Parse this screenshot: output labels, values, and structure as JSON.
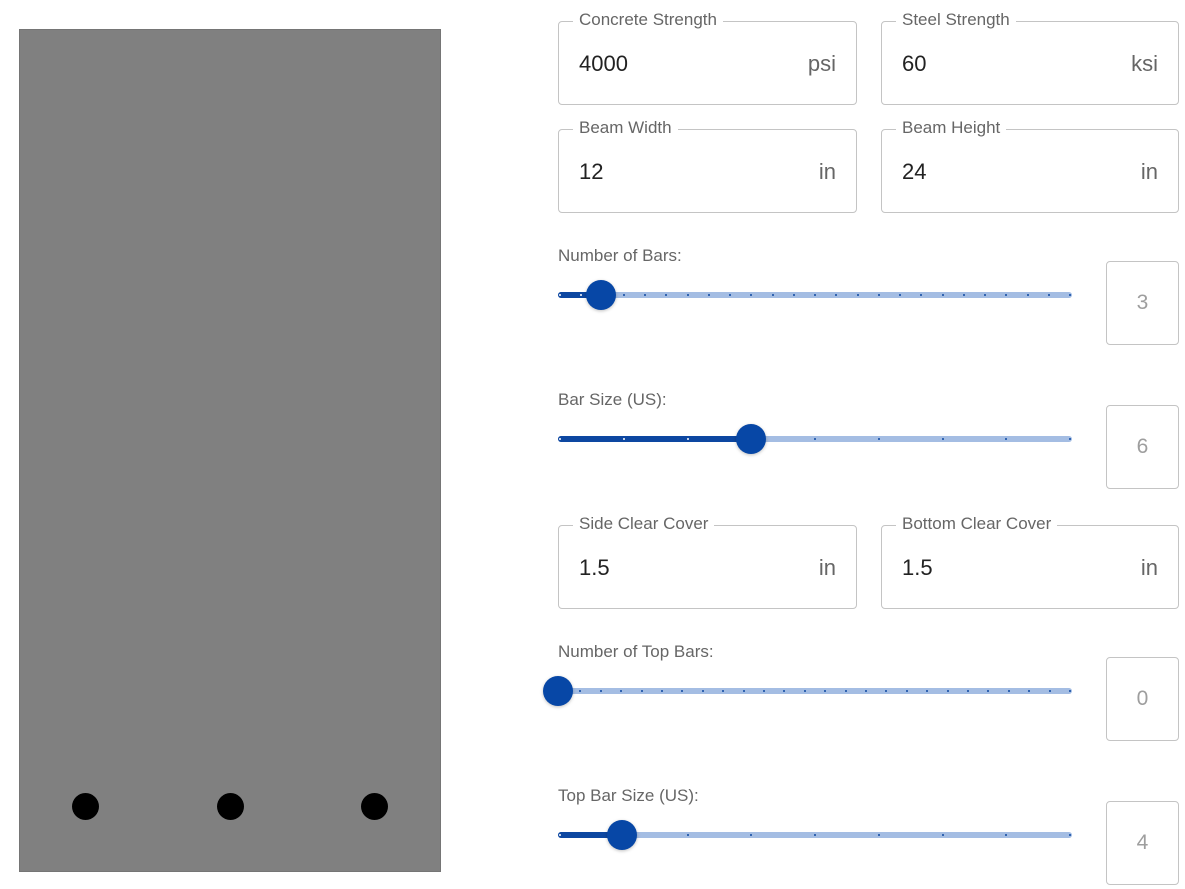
{
  "colors": {
    "beam": "#808080",
    "rebar": "#000000",
    "accent": "#0747a6",
    "track": "#a4bde3"
  },
  "section": {
    "bottom_bar_count": 3,
    "top_bar_count": 0
  },
  "fields": {
    "concrete_strength": {
      "label": "Concrete Strength",
      "value": "4000",
      "unit": "psi"
    },
    "steel_strength": {
      "label": "Steel Strength",
      "value": "60",
      "unit": "ksi"
    },
    "beam_width": {
      "label": "Beam Width",
      "value": "12",
      "unit": "in"
    },
    "beam_height": {
      "label": "Beam Height",
      "value": "24",
      "unit": "in"
    },
    "side_clear_cover": {
      "label": "Side Clear Cover",
      "value": "1.5",
      "unit": "in"
    },
    "bottom_clear_cover": {
      "label": "Bottom Clear Cover",
      "value": "1.5",
      "unit": "in"
    }
  },
  "sliders": {
    "num_bars": {
      "label": "Number of Bars:",
      "value": "3",
      "fraction": 0.083,
      "tick_count": 25
    },
    "bar_size": {
      "label": "Bar Size (US):",
      "value": "6",
      "fraction": 0.375,
      "tick_count": 9
    },
    "num_top_bars": {
      "label": "Number of Top Bars:",
      "value": "0",
      "fraction": 0.0,
      "tick_count": 26
    },
    "top_bar_size": {
      "label": "Top Bar Size (US):",
      "value": "4",
      "fraction": 0.125,
      "tick_count": 9
    }
  }
}
